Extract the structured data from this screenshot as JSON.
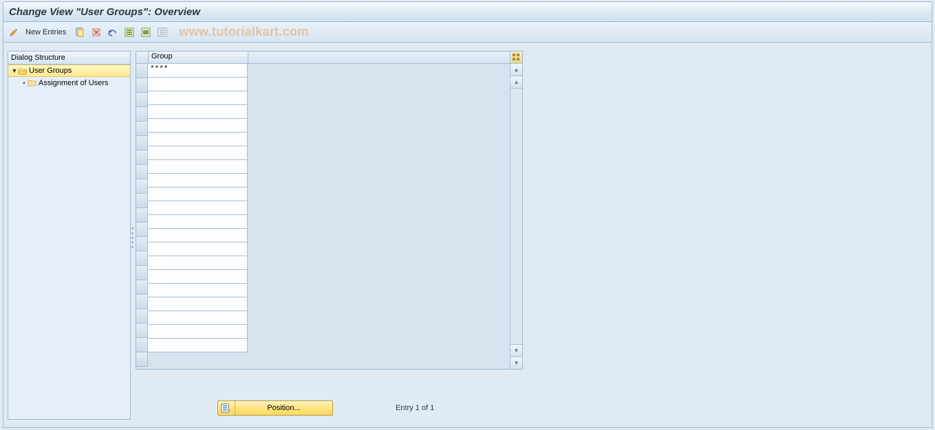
{
  "title": "Change View \"User Groups\": Overview",
  "toolbar": {
    "new_entries_label": "New Entries"
  },
  "watermark": "www.tutorialkart.com",
  "tree": {
    "header": "Dialog Structure",
    "nodes": [
      {
        "label": "User Groups",
        "selected": true,
        "expanded": true,
        "level": 0,
        "open": true
      },
      {
        "label": "Assignment of Users",
        "selected": false,
        "expanded": false,
        "level": 1,
        "open": false
      }
    ]
  },
  "table": {
    "column_header": "Group",
    "rows": [
      "****",
      "",
      "",
      "",
      "",
      "",
      "",
      "",
      "",
      "",
      "",
      "",
      "",
      "",
      "",
      "",
      "",
      "",
      "",
      "",
      ""
    ]
  },
  "footer": {
    "position_label": "Position...",
    "entry_text": "Entry 1 of 1"
  }
}
